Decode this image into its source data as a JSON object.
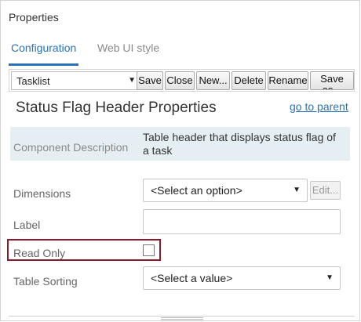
{
  "panel": {
    "title": "Properties"
  },
  "tabs": [
    {
      "label": "Configuration",
      "active": true
    },
    {
      "label": "Web UI style",
      "active": false
    }
  ],
  "toolbar": {
    "list_value": "Tasklist",
    "buttons": {
      "save": "Save",
      "close": "Close",
      "new": "New...",
      "delete": "Delete",
      "rename": "Rename",
      "save_as": "Save as..."
    }
  },
  "section": {
    "title": "Status Flag Header Properties",
    "goto_parent": "go to parent"
  },
  "description": {
    "label": "Component Description",
    "value": "Table header that displays status flag of a task"
  },
  "fields": {
    "dimensions": {
      "label": "Dimensions",
      "value": "<Select an option>",
      "edit_label": "Edit..."
    },
    "label": {
      "label": "Label",
      "value": ""
    },
    "read_only": {
      "label": "Read Only",
      "checked": false
    },
    "table_sorting": {
      "label": "Table Sorting",
      "value": "<Select a value>"
    }
  },
  "colors": {
    "accent": "#2a73b8",
    "highlight_border": "#8b1c2b",
    "description_bg": "#e5eef2"
  }
}
